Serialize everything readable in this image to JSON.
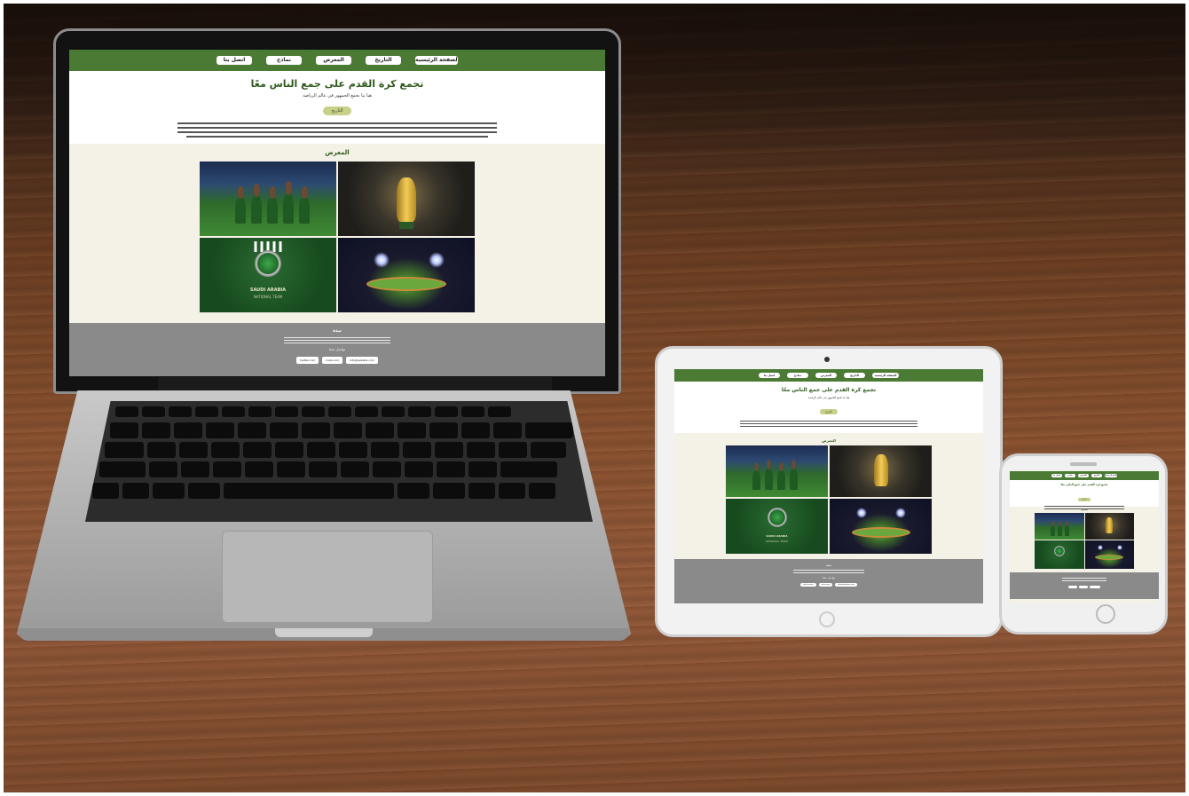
{
  "site": {
    "nav": [
      "الصفحة الرئيسية",
      "التاريخ",
      "المعرض",
      "نماذج",
      "اتصل بنا"
    ],
    "hero_title": "تجمع كرة القدم على جمع الناس معًا",
    "hero_subtitle": "هيا بنا نجمع الجمهور في عالم الرياضة",
    "history_button": "التاريخ",
    "gallery_title": "المعرض",
    "gallery_tiles": [
      "team-photo",
      "world-cup-trophy",
      "saudi-national-team-logo",
      "stadium-night"
    ],
    "logo_text": "SAUDI ARABIA",
    "logo_subtext": "NATIONAL TEAM",
    "footer_title": "نبذة",
    "footer_contact_title": "تواصل معنا",
    "footer_links": [
      "twitter.com",
      "insta.com",
      "info@website.com"
    ]
  },
  "colors": {
    "nav_green": "#4a7a33",
    "title_green": "#2e5a1c",
    "footer_gray": "#8a8a8a",
    "pill_olive": "#c8d08a"
  }
}
